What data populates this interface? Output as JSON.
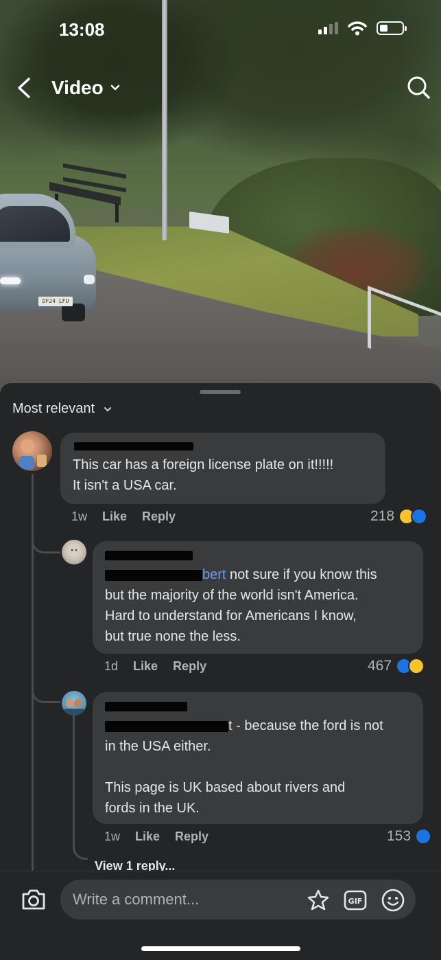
{
  "status_bar": {
    "time": "13:08"
  },
  "header": {
    "title": "Video"
  },
  "video": {
    "plate_text": "DF24 LFU"
  },
  "comments_panel": {
    "sort_label": "Most relevant",
    "comments": [
      {
        "text_line1": "This car has a foreign license plate on it!!!!!",
        "text_line2": "It isn't a USA car.",
        "age": "1w",
        "like_label": "Like",
        "reply_label": "Reply",
        "reaction_count": "218",
        "reactions": [
          "haha",
          "like"
        ]
      },
      {
        "mention_tail": "bert",
        "text_line1": " not sure if you know this",
        "text_line2": "but the majority of the world isn't America.",
        "text_line3": "Hard to understand for Americans I know,",
        "text_line4": "but true none the less.",
        "age": "1d",
        "like_label": "Like",
        "reply_label": "Reply",
        "reaction_count": "467",
        "reactions": [
          "like",
          "haha"
        ]
      },
      {
        "mention_tail": "t",
        "text_line1": " - because the ford is not",
        "text_line2": "in the USA either.",
        "text_line3": "This page is UK based about rivers and",
        "text_line4": "fords in the UK.",
        "age": "1w",
        "like_label": "Like",
        "reply_label": "Reply",
        "reaction_count": "153",
        "reactions": [
          "like"
        ]
      }
    ],
    "view_replies_label": "View 1 reply..."
  },
  "composer": {
    "placeholder": "Write a comment..."
  },
  "colors": {
    "accent_blue": "#1b74e4",
    "mention_blue": "#6b9cf3",
    "sheet_bg": "#242526",
    "bubble_bg": "#3a3b3c"
  }
}
